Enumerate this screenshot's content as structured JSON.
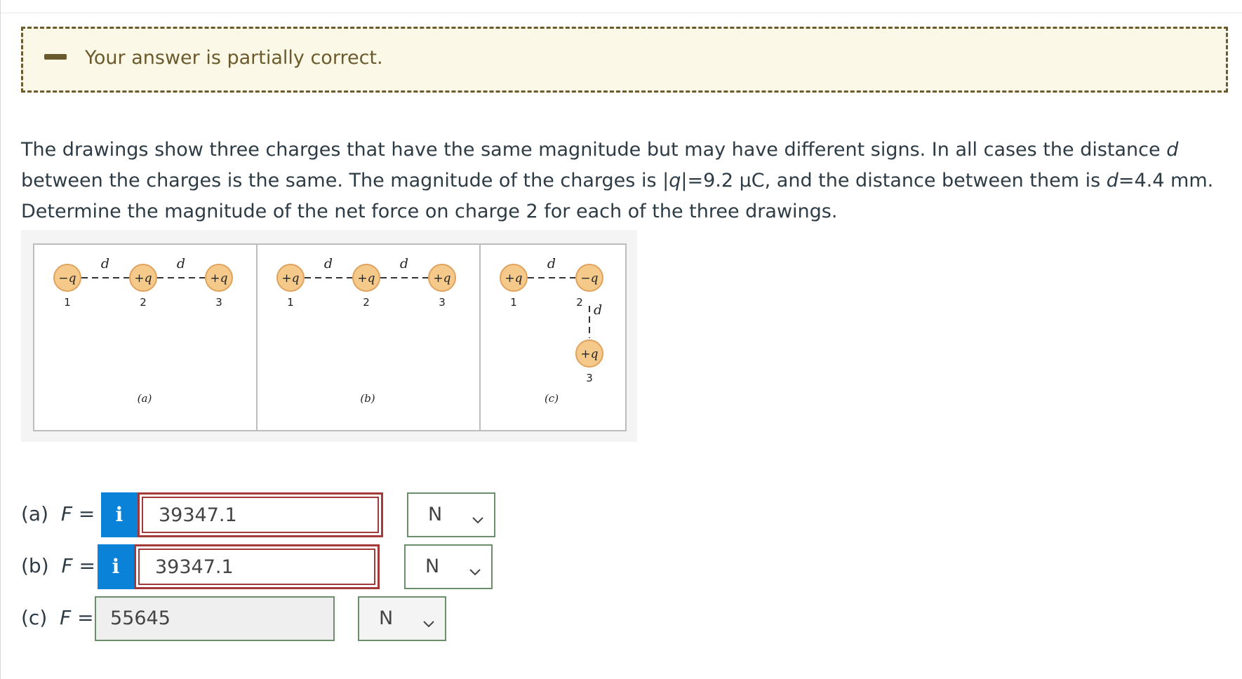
{
  "feedback": {
    "message": "Your answer is partially correct."
  },
  "question": {
    "line1_a": "The drawings show three charges that have the same magnitude but may have different signs. In all cases the distance ",
    "line1_var": "d",
    "line2_a": "between the charges is the same. The magnitude of the charges is |",
    "line2_q": "q",
    "line2_b": "|=9.2 μC, and the distance between them is ",
    "line2_d": "d",
    "line2_c": "=4.4 mm.",
    "line3": "Determine the magnitude of the net force on charge 2 for each of the three drawings."
  },
  "figure": {
    "panels": [
      {
        "caption": "(a)",
        "charges": [
          {
            "sign": "−q",
            "number": "1"
          },
          {
            "sign": "+q",
            "number": "2"
          },
          {
            "sign": "+q",
            "number": "3"
          }
        ]
      },
      {
        "caption": "(b)",
        "charges": [
          {
            "sign": "+q",
            "number": "1"
          },
          {
            "sign": "+q",
            "number": "2"
          },
          {
            "sign": "+q",
            "number": "3"
          }
        ]
      },
      {
        "caption": "(c)",
        "charges": [
          {
            "sign": "+q",
            "number": "1"
          },
          {
            "sign": "−q",
            "number": "2"
          },
          {
            "sign": "+q",
            "number": "3"
          }
        ]
      }
    ],
    "distance_label": "d",
    "colors": {
      "charge_fill": "#f5c98a",
      "charge_edge": "#e0a25c",
      "panel_border": "#bdbdbd"
    }
  },
  "answers": [
    {
      "label": "(a)",
      "var": "F",
      "eq": " =",
      "value": "39347.1",
      "unit": "N",
      "status": "incorrect",
      "has_info": true
    },
    {
      "label": "(b)",
      "var": "F",
      "eq": " =",
      "value": "39347.1",
      "unit": "N",
      "status": "incorrect",
      "has_info": true
    },
    {
      "label": "(c)",
      "var": "F",
      "eq": " =",
      "value": "55645",
      "unit": "N",
      "status": "correct",
      "has_info": false
    }
  ],
  "info_glyph": "i",
  "chevron_glyph": "⌵",
  "colors": {
    "info_button": "#0a82d8",
    "incorrect_border": "#a33a3a",
    "correct_border": "#6b8f6b",
    "banner_bg": "#fcf8e7",
    "banner_text": "#6b5a2b"
  }
}
